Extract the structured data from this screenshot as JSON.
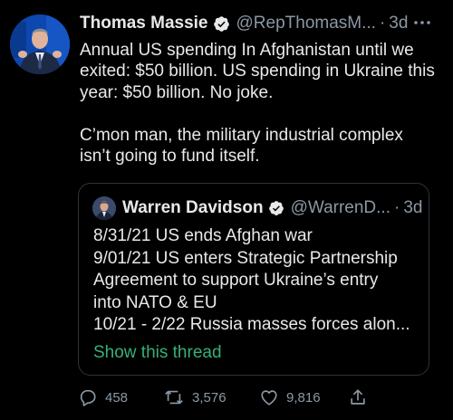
{
  "tweet": {
    "author": {
      "display_name": "Thomas Massie",
      "handle": "@RepThomasM...",
      "time": "3d",
      "verified_icon": "verified-badge-icon"
    },
    "separator": "·",
    "text": [
      "Annual US spending In Afghanistan until we exited: $50 billion. US spending in Ukraine this year: $50 billion. No joke.",
      "C’mon man, the military industrial complex isn’t going to fund itself."
    ],
    "quote": {
      "author": {
        "display_name": "Warren Davidson",
        "handle": "@WarrenD...",
        "time": "3d"
      },
      "lines": [
        "8/31/21 US ends Afghan war",
        "9/01/21 US enters Strategic Partnership",
        "Agreement to support Ukraine’s entry",
        "into NATO & EU",
        "10/21 - 2/22 Russia masses forces alon..."
      ],
      "show_thread_label": "Show this thread"
    },
    "actions": {
      "replies": "458",
      "retweets": "3,576",
      "likes": "9,816"
    }
  },
  "colors": {
    "background": "#000000",
    "text": "#e7e9ea",
    "muted": "#8b98a5",
    "verified": "#e7e9ea",
    "link": "#35b07a",
    "border": "#2f3336"
  }
}
